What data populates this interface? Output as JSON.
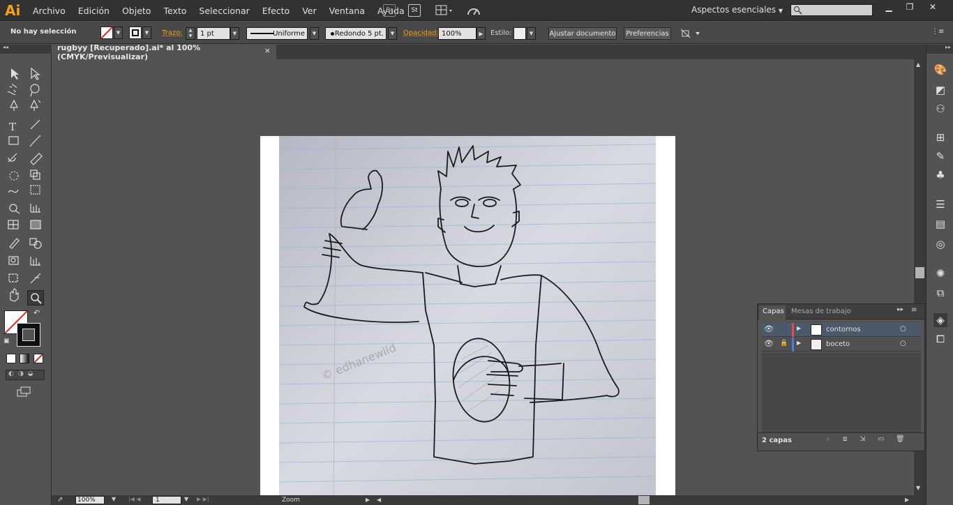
{
  "app": {
    "logo": "Ai",
    "workspace": "Aspectos esenciales"
  },
  "menu": [
    "Archivo",
    "Edición",
    "Objeto",
    "Texto",
    "Seleccionar",
    "Efecto",
    "Ver",
    "Ventana",
    "Ayuda"
  ],
  "menu_icons": {
    "br": "Br",
    "st": "St"
  },
  "control": {
    "selection_status": "No hay selección",
    "stroke_label": "Trazo:",
    "stroke_value": "1 pt",
    "stroke_profile": "Uniforme",
    "brush": "Redondo 5 pt.",
    "opacity_label": "Opacidad:",
    "opacity_value": "100%",
    "style_label": "Estilo:",
    "fit_button": "Ajustar documento",
    "prefs_button": "Preferencias"
  },
  "document": {
    "tab_title": "rugbyy [Recuperado].ai* al 100% (CMYK/Previsualizar)",
    "close": "×"
  },
  "status": {
    "zoom": "100%",
    "page": "1",
    "tool_name": "Zoom"
  },
  "layers_panel": {
    "tabs": [
      "Capas",
      "Mesas de trabajo"
    ],
    "layers": [
      {
        "name": "contornos",
        "color": "#e84a4a",
        "locked": false,
        "selected": true
      },
      {
        "name": "boceto",
        "color": "#4a7ae8",
        "locked": true,
        "selected": false
      }
    ],
    "count": "2 capas"
  },
  "colors": {
    "accent": "#f7a01e",
    "ui_dark": "#323232",
    "ui_mid": "#535353"
  },
  "artwork": {
    "watermark": "© edhanewild"
  }
}
